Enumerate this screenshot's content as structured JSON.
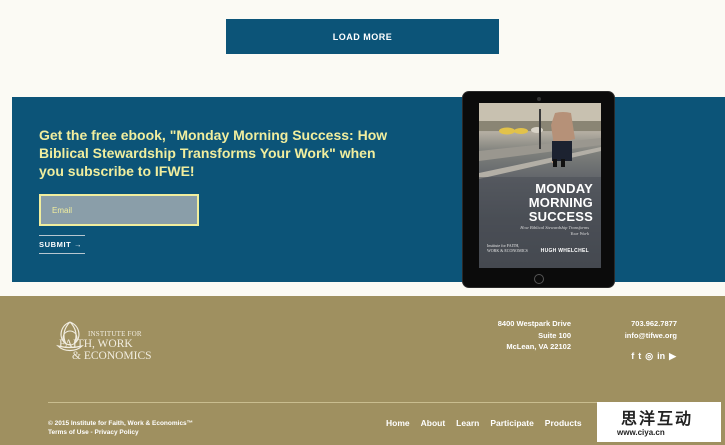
{
  "load_more": {
    "label": "LOAD MORE"
  },
  "promo": {
    "heading": "Get the free ebook, \"Monday Morning Success: How Biblical Stewardship Transforms Your Work\" when you subscribe to IFWE!",
    "email_placeholder": "Email",
    "submit_label": "SUBMIT →",
    "ebook": {
      "title_line1": "MONDAY",
      "title_line2": "MORNING",
      "title_line3": "SUCCESS",
      "subtitle": "How Biblical Stewardship Transforms Your Work",
      "author": "HUGH WHELCHEL",
      "logo_text": "Institute for FAITH, WORK & ECONOMICS"
    }
  },
  "footer": {
    "logo": {
      "line1": "INSTITUTE FOR",
      "line2": "FAITH, WORK",
      "line3": "& ECONOMICS"
    },
    "address": {
      "line1": "8400 Westpark Drive",
      "line2": "Suite 100",
      "line3": "McLean, VA 22102"
    },
    "contact": {
      "phone": "703.962.7877",
      "email": "info@tifwe.org"
    },
    "social": {
      "facebook": "f",
      "twitter": "t",
      "instagram": "◎",
      "linkedin": "in",
      "youtube": "▶"
    },
    "copyright": "© 2015 Institute for Faith, Work & Economics™",
    "terms": "Terms of Use",
    "separator": " - ",
    "privacy": "Privacy Policy",
    "nav": [
      "Home",
      "About",
      "Learn",
      "Participate",
      "Products"
    ]
  },
  "watermark": {
    "cn": "思洋互动",
    "url": "www.ciya.cn"
  },
  "colors": {
    "brand_blue": "#0c5478",
    "accent_yellow": "#f1ee9e",
    "footer_gold": "#9f9060"
  }
}
